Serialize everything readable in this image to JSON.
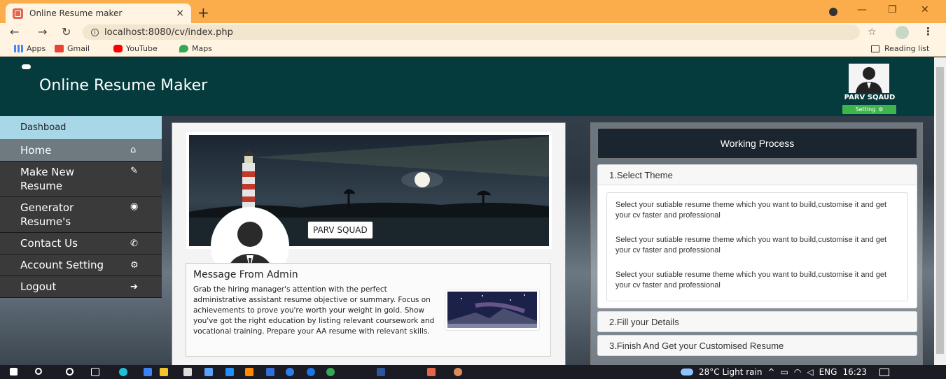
{
  "browser": {
    "tab_title": "Online Resume maker",
    "tab_close": "×",
    "new_tab": "+",
    "url": "localhost:8080/cv/index.php",
    "bookmarks": [
      "Apps",
      "Gmail",
      "YouTube",
      "Maps"
    ],
    "reading_list": "Reading list"
  },
  "header": {
    "site_title": "Online Resume Maker",
    "profile_name": "PARV SQAUD",
    "setting_label": "Setting"
  },
  "sidebar": {
    "dashboard": "Dashboad",
    "items": [
      {
        "label": "Home",
        "icon": "home-icon"
      },
      {
        "label": "Make New Resume",
        "icon": "edit-icon"
      },
      {
        "label": "Generator Resume's",
        "icon": "user-icon"
      },
      {
        "label": "Contact Us",
        "icon": "phone-icon"
      },
      {
        "label": "Account Setting",
        "icon": "gear-icon"
      },
      {
        "label": "Logout",
        "icon": "logout-icon"
      }
    ]
  },
  "main": {
    "cover_name": "PARV SQUAD",
    "admin_title": "Message From Admin",
    "admin_text": "Grab the hiring manager's attention with the perfect administrative assistant resume objective or summary. Focus on achievements to prove you're worth your weight in gold. Show you've got the right education by listing relevant coursework and vocational training. Prepare your AA resume with relevant skills."
  },
  "process": {
    "title": "Working Process",
    "steps": [
      {
        "label": "1.Select Theme"
      },
      {
        "label": "2.Fill your Details"
      },
      {
        "label": "3.Finish And Get your Customised Resume"
      }
    ],
    "step1_lines": [
      "Select your sutiable resume theme which you want to build,customise it and get your cv faster and professional",
      "Select your sutiable resume theme which you want to build,customise it and get your cv faster and professional",
      "Select your sutiable resume theme which you want to build,customise it and get your cv faster and professional"
    ]
  },
  "taskbar": {
    "weather": "28°C  Light rain",
    "lang": "ENG",
    "time": "16:23"
  }
}
